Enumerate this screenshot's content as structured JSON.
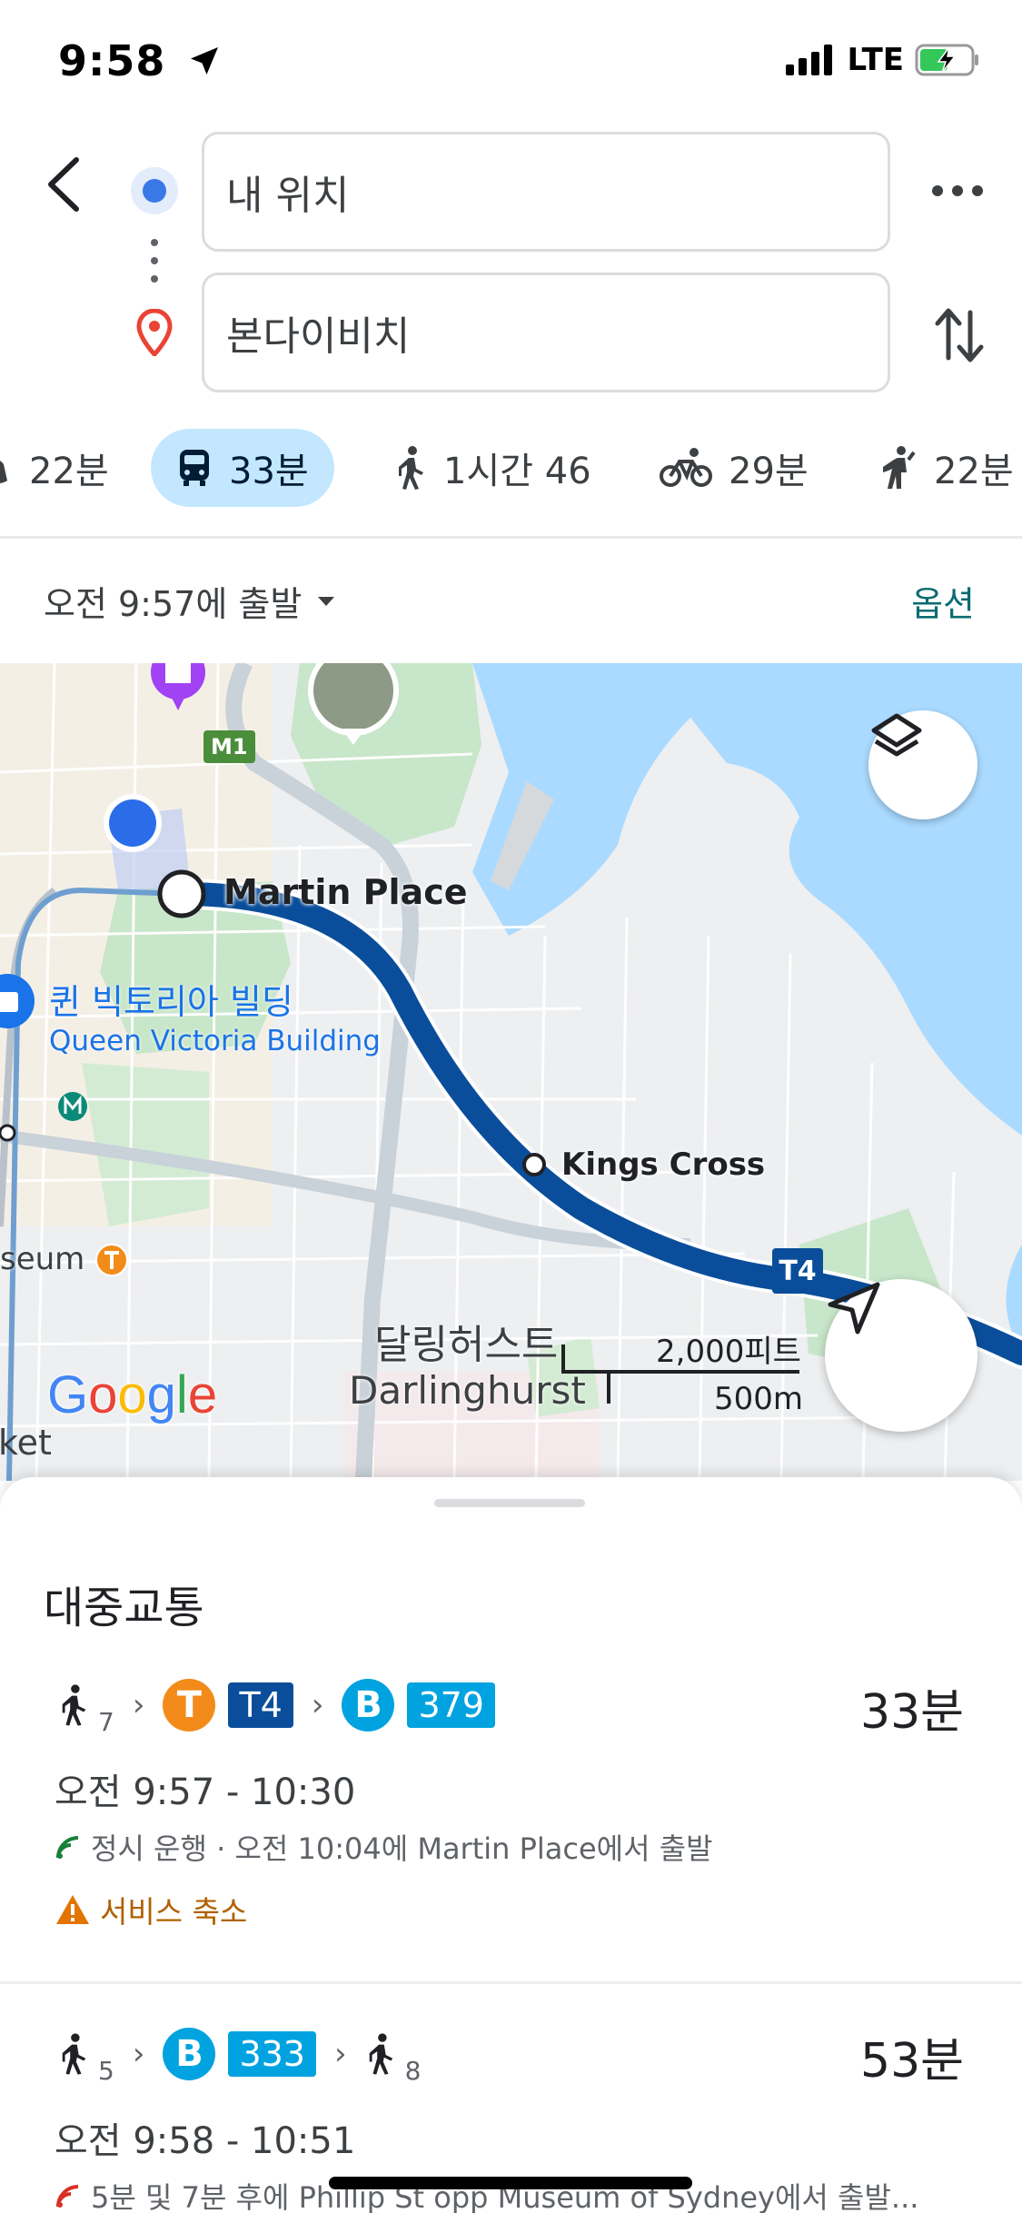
{
  "status_bar": {
    "time": "9:58",
    "network": "LTE"
  },
  "search": {
    "origin": "내 위치",
    "destination": "본다이비치"
  },
  "modes": [
    {
      "label": "22분",
      "icon": "car-icon"
    },
    {
      "label": "33분",
      "icon": "transit-icon",
      "active": true
    },
    {
      "label": "1시간 46",
      "icon": "walk-icon"
    },
    {
      "label": "29분",
      "icon": "bike-icon"
    },
    {
      "label": "22분",
      "icon": "rideshare-icon"
    }
  ],
  "depart": {
    "label": "오전 9:57에 출발",
    "options_label": "옵션"
  },
  "map": {
    "stations": {
      "martin_place": "Martin Place",
      "kings_cross": "Kings Cross"
    },
    "qvb_ko": "퀸 빅토리아 빌딩",
    "qvb_en": "Queen Victoria Building",
    "darlinghurst_ko": "달링허스트",
    "darlinghurst_en": "Darlinghurst",
    "museum_partial": "seum",
    "market_partial": "ket",
    "road_shield": "M1",
    "line_badge": "T4",
    "scale_ft": "2,000피트",
    "scale_m": "500m",
    "logo": "Google",
    "colors": {
      "water": "#aadaff",
      "park": "#c8e6c9",
      "route": "#0a4e9b",
      "road": "#c9d1d9"
    }
  },
  "sheet": {
    "title": "대중교통",
    "routes": [
      {
        "walk_start": "7",
        "train_mode": "T",
        "train_line": "T4",
        "bus_mode": "B",
        "bus_line": "379",
        "duration": "33분",
        "times": "오전 9:57 - 10:30",
        "realtime": "정시 운행 · 오전 10:04에 Martin Place에서 출발",
        "alert": "서비스 축소"
      },
      {
        "walk_start": "5",
        "bus_mode": "B",
        "bus_line": "333",
        "walk_end": "8",
        "duration": "53분",
        "times": "오전 9:58 - 10:51",
        "realtime": "5분 및 7분 후에 Phillip St opp Museum of Sydney에서 출발..."
      }
    ]
  }
}
